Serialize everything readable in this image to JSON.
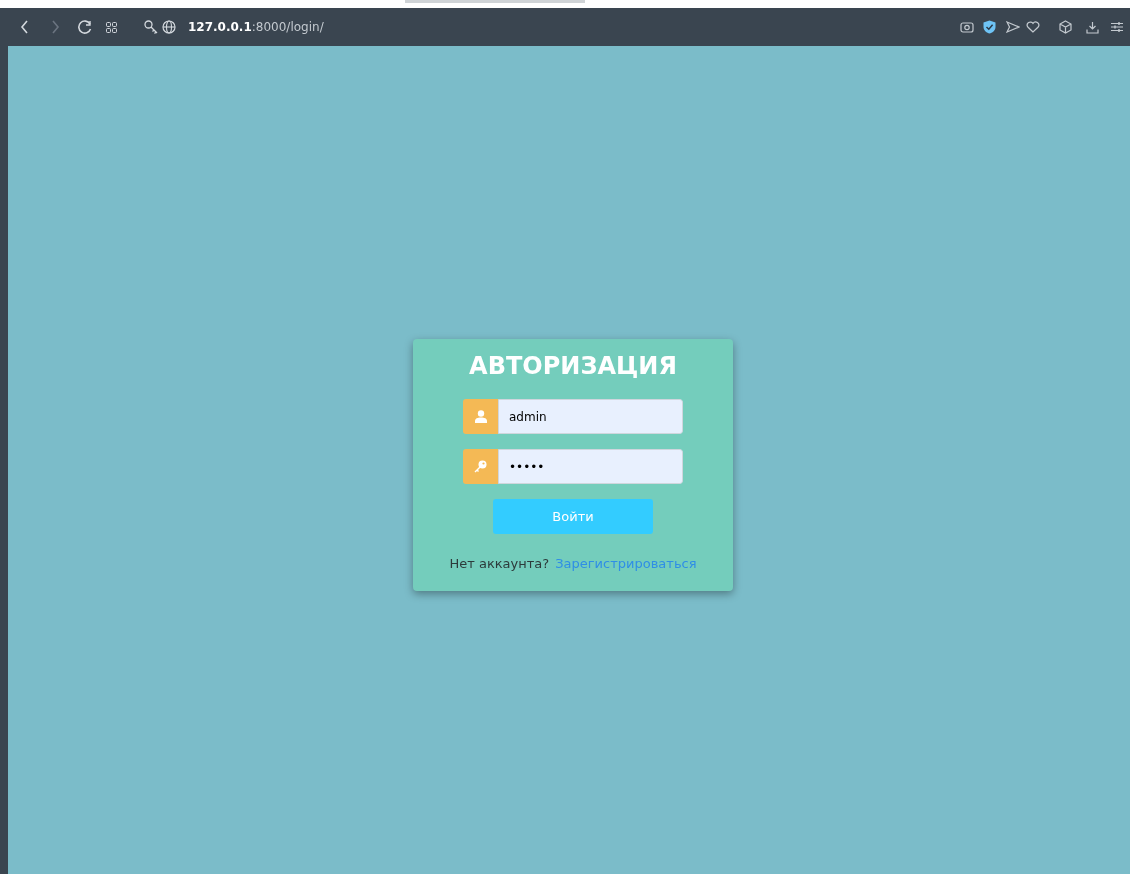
{
  "browser": {
    "url": "**127.0.0.1**:8000/login/"
  },
  "login": {
    "title": "АВТОРИЗАЦИЯ",
    "fields": [
      {
        "kind": "user",
        "value": "admin"
      },
      {
        "kind": "password",
        "value": "•••••"
      }
    ],
    "submit": "Войти",
    "footer": {
      "text": "Нет аккаунта?",
      "link": "Зарегистрироваться"
    }
  }
}
